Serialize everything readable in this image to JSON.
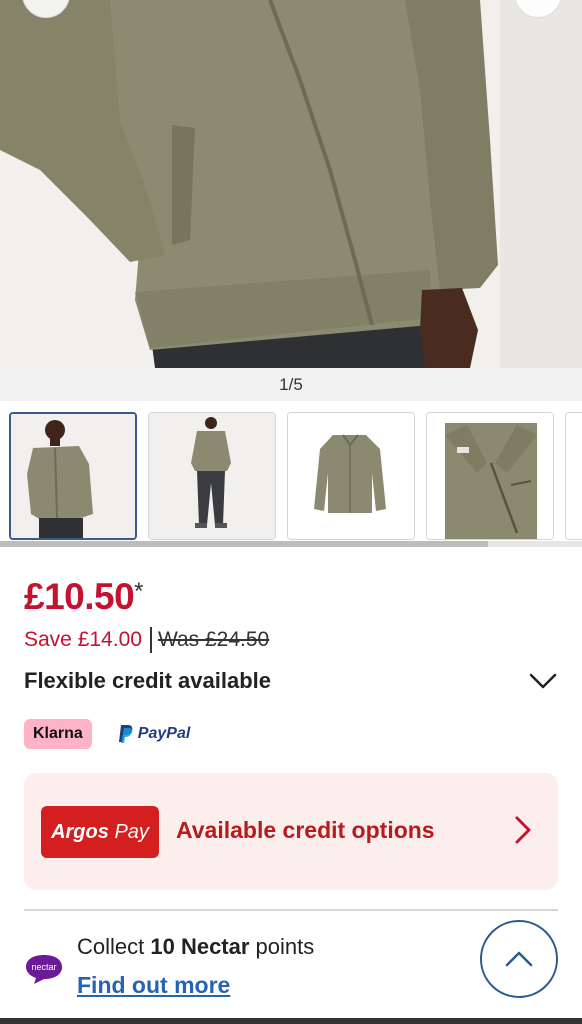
{
  "gallery": {
    "counter": "1/5",
    "thumbnails": [
      "jacket-front-model",
      "jacket-full-length-model",
      "jacket-flat-lay",
      "jacket-collar-detail"
    ]
  },
  "price": {
    "current": "£10.50",
    "asterisk": "*",
    "save": "Save £14.00",
    "was": "Was £24.50"
  },
  "credit": {
    "label": "Flexible credit available"
  },
  "payment_logos": {
    "klarna": "Klarna",
    "paypal": "PayPal"
  },
  "argos_pay": {
    "logo_brand": "Argos",
    "logo_pay": "Pay",
    "text": "Available credit options"
  },
  "nectar": {
    "logo": "nectar",
    "prefix": "Collect ",
    "points": "10 Nectar",
    "suffix": " points",
    "link": "Find out more"
  },
  "colors": {
    "price_red": "#c41230",
    "argos_red": "#d31f1f",
    "link_blue": "#2863b2",
    "jacket_khaki": "#8a8a70"
  }
}
